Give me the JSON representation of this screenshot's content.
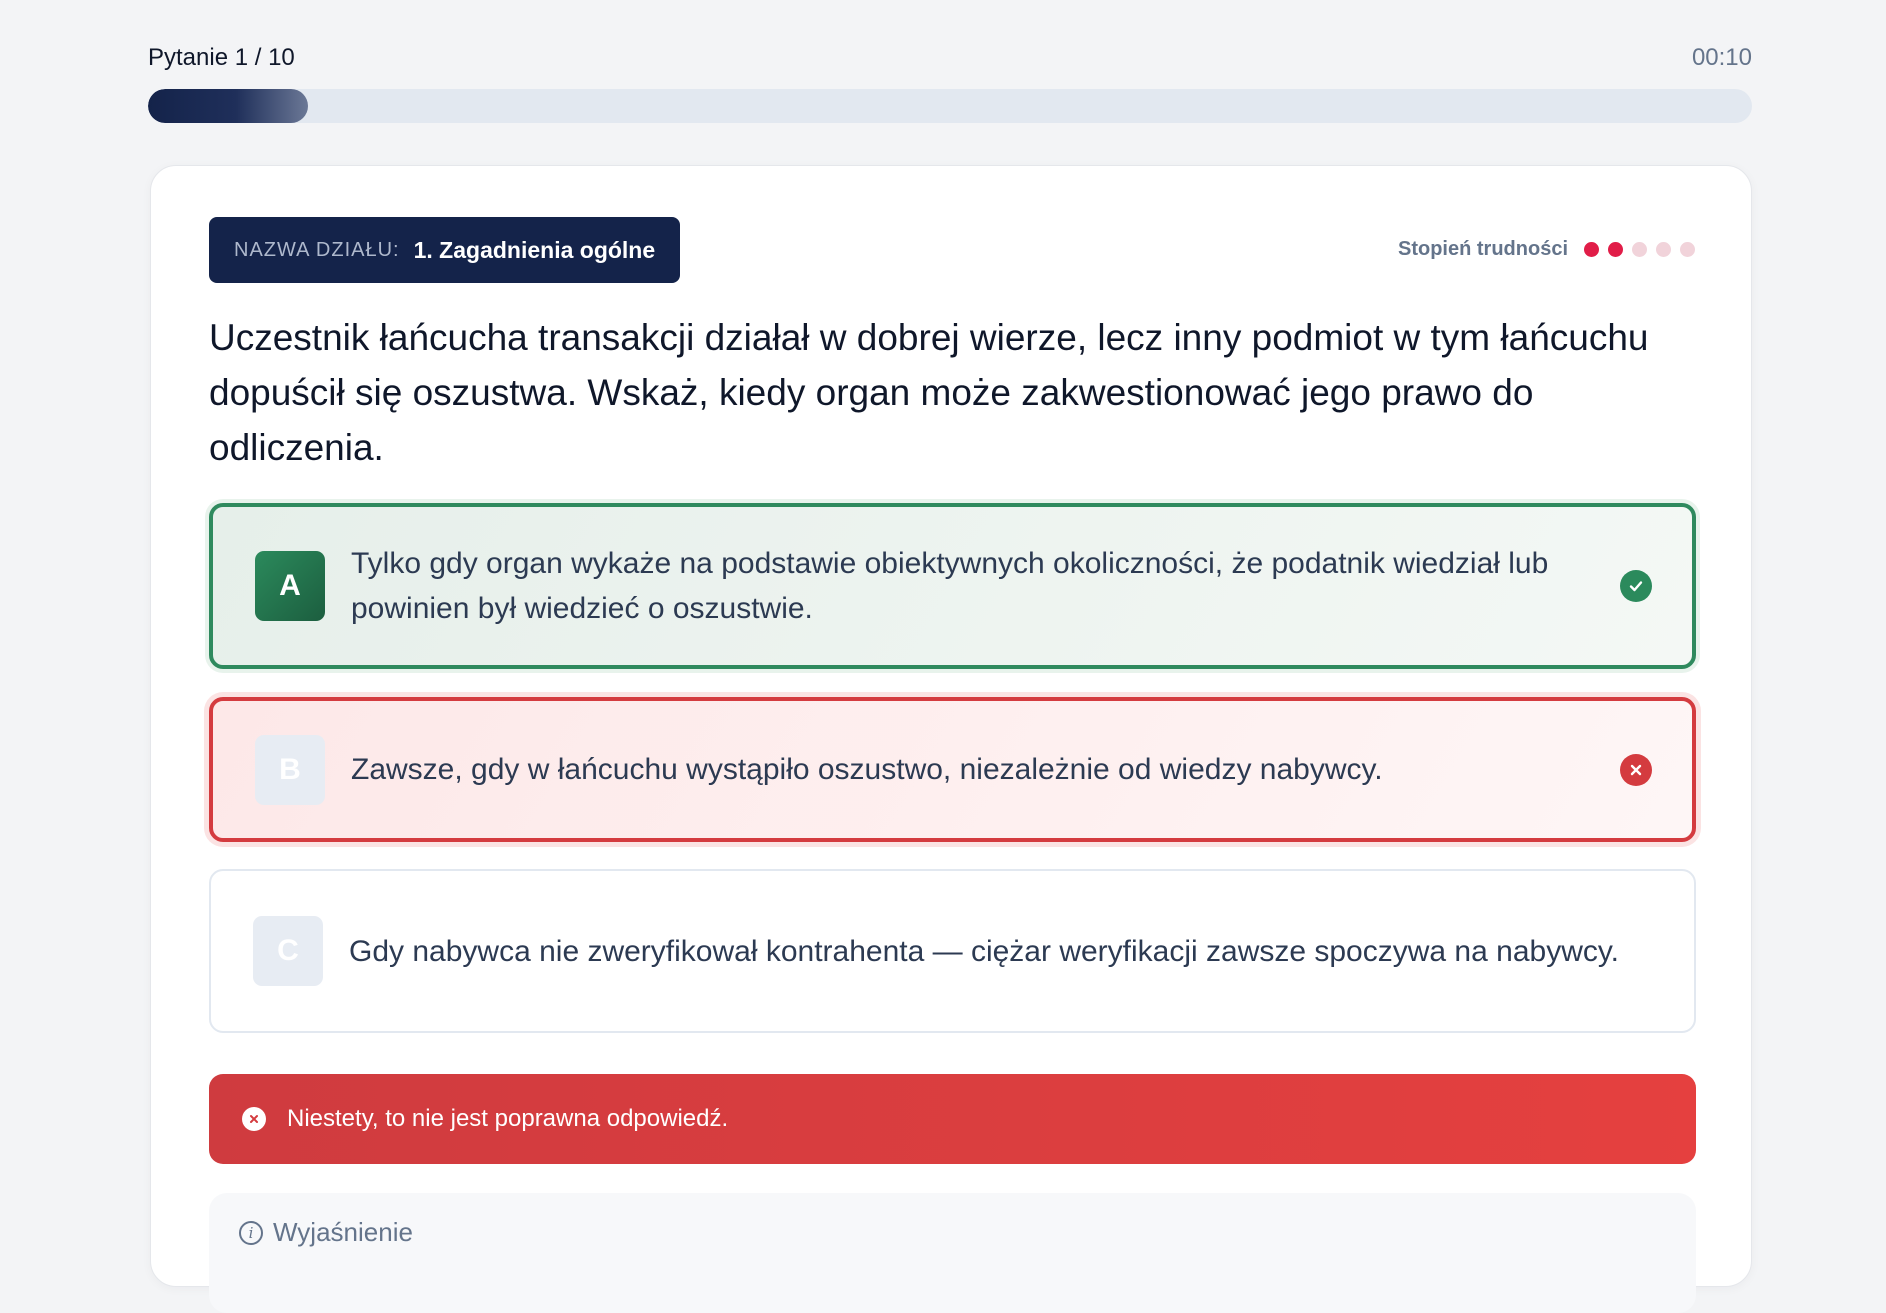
{
  "header": {
    "question_counter": "Pytanie 1 / 10",
    "timer": "00:10",
    "progress_fraction": 0.1
  },
  "section": {
    "label": "NAZWA DZIAŁU:",
    "value": "1. Zagadnienia ogólne"
  },
  "difficulty": {
    "label": "Stopień trudności",
    "level": 2,
    "max": 5
  },
  "question": {
    "text": "Uczestnik łańcucha transakcji działał w dobrej wierze, lecz inny podmiot w tym łańcuchu dopuścił się oszustwa. Wskaż, kiedy organ może zakwestionować jego prawo do odliczenia."
  },
  "options": [
    {
      "letter": "A",
      "text": " Tylko gdy organ wykaże na podstawie obiektywnych okoliczności, że podatnik wiedział lub powinien był wiedzieć o oszustwie.",
      "state": "correct",
      "icon": "check-circle-icon"
    },
    {
      "letter": "B",
      "text": "Zawsze, gdy w łańcuchu wystąpiło oszustwo, niezależnie od wiedzy nabywcy.",
      "state": "wrong",
      "icon": "x-circle-icon"
    },
    {
      "letter": "C",
      "text": "Gdy nabywca nie zweryfikował kontrahenta — ciężar weryfikacji zawsze spoczywa na nabywcy.",
      "state": "neutral"
    }
  ],
  "feedback": {
    "text": "Niestety, to nie jest poprawna odpowiedź.",
    "icon": "x-circle-icon"
  },
  "explanation": {
    "title": "Wyjaśnienie",
    "icon": "info-icon"
  },
  "colors": {
    "navy": "#14234a",
    "correct": "#2b8a5c",
    "wrong": "#d43b3f",
    "difficulty_on": "#e11d48"
  }
}
